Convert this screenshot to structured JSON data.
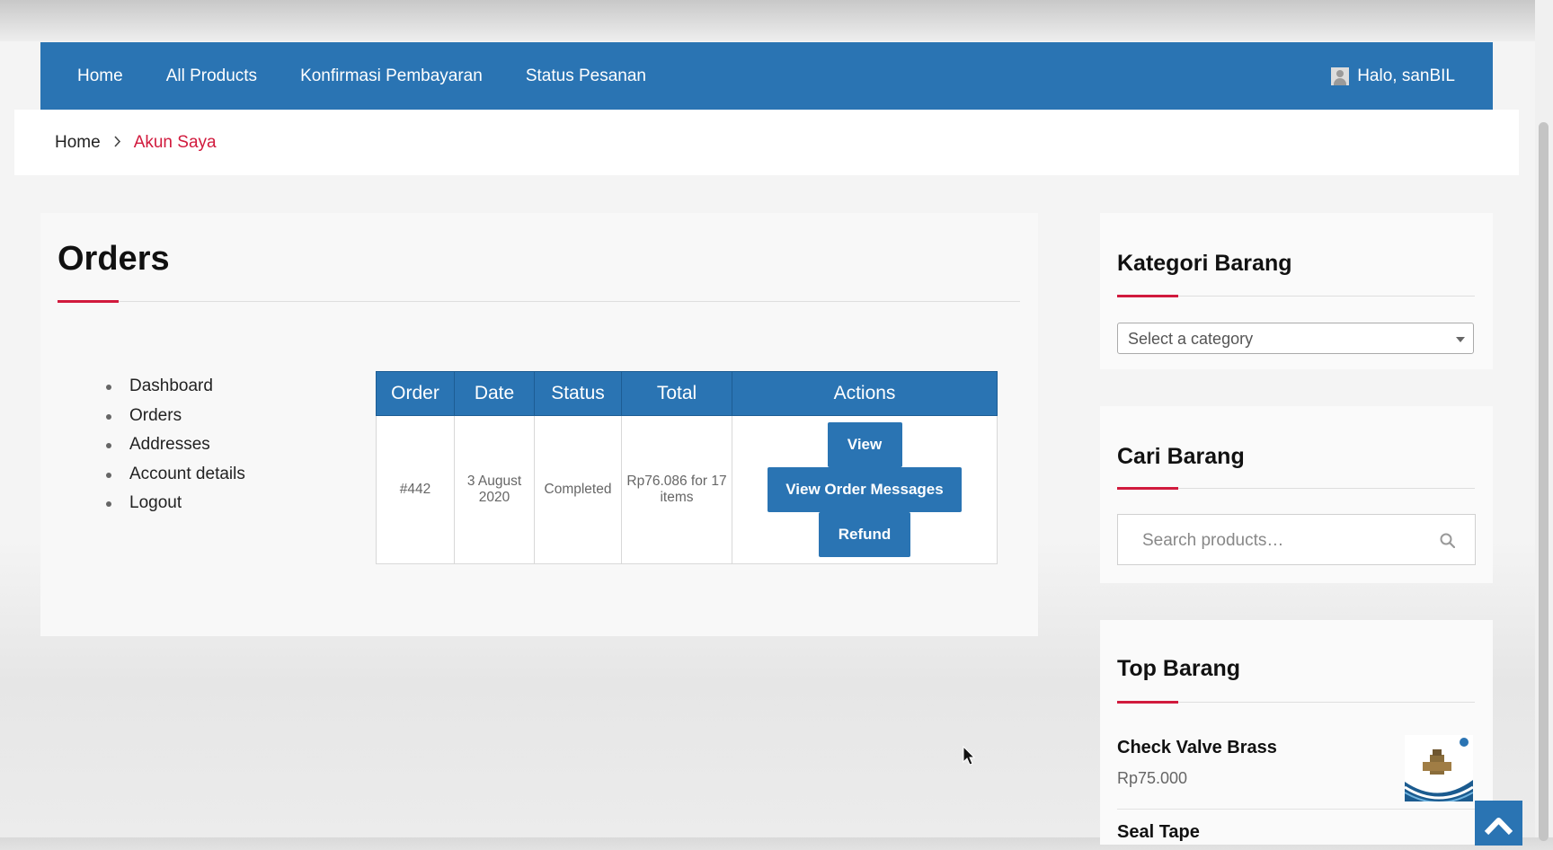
{
  "navbar": {
    "items": [
      "Home",
      "All Products",
      "Konfirmasi Pembayaran",
      "Status Pesanan"
    ],
    "user_greeting": "Halo, sanBIL"
  },
  "breadcrumb": {
    "home": "Home",
    "current": "Akun Saya"
  },
  "main": {
    "title": "Orders",
    "account_nav": [
      "Dashboard",
      "Orders",
      "Addresses",
      "Account details",
      "Logout"
    ],
    "table": {
      "headers": [
        "Order",
        "Date",
        "Status",
        "Total",
        "Actions"
      ],
      "rows": [
        {
          "order": "#442",
          "date": "3 August 2020",
          "status": "Completed",
          "total": "Rp76.086 for 17 items",
          "actions": [
            "View",
            "View Order Messages",
            "Refund"
          ]
        }
      ]
    }
  },
  "sidebar": {
    "kategori": {
      "title": "Kategori Barang",
      "select_placeholder": "Select a category"
    },
    "cari": {
      "title": "Cari Barang",
      "search_placeholder": "Search products…"
    },
    "top": {
      "title": "Top Barang",
      "products": [
        {
          "name": "Check Valve Brass",
          "price": "Rp75.000"
        },
        {
          "name": "Seal Tape",
          "price": ""
        }
      ]
    }
  },
  "colors": {
    "primary": "#2a74b3",
    "accent": "#d11a3d"
  },
  "icons": [
    "user-icon",
    "chevron-right-icon",
    "caret-down-icon",
    "search-icon",
    "arrow-up-icon"
  ]
}
